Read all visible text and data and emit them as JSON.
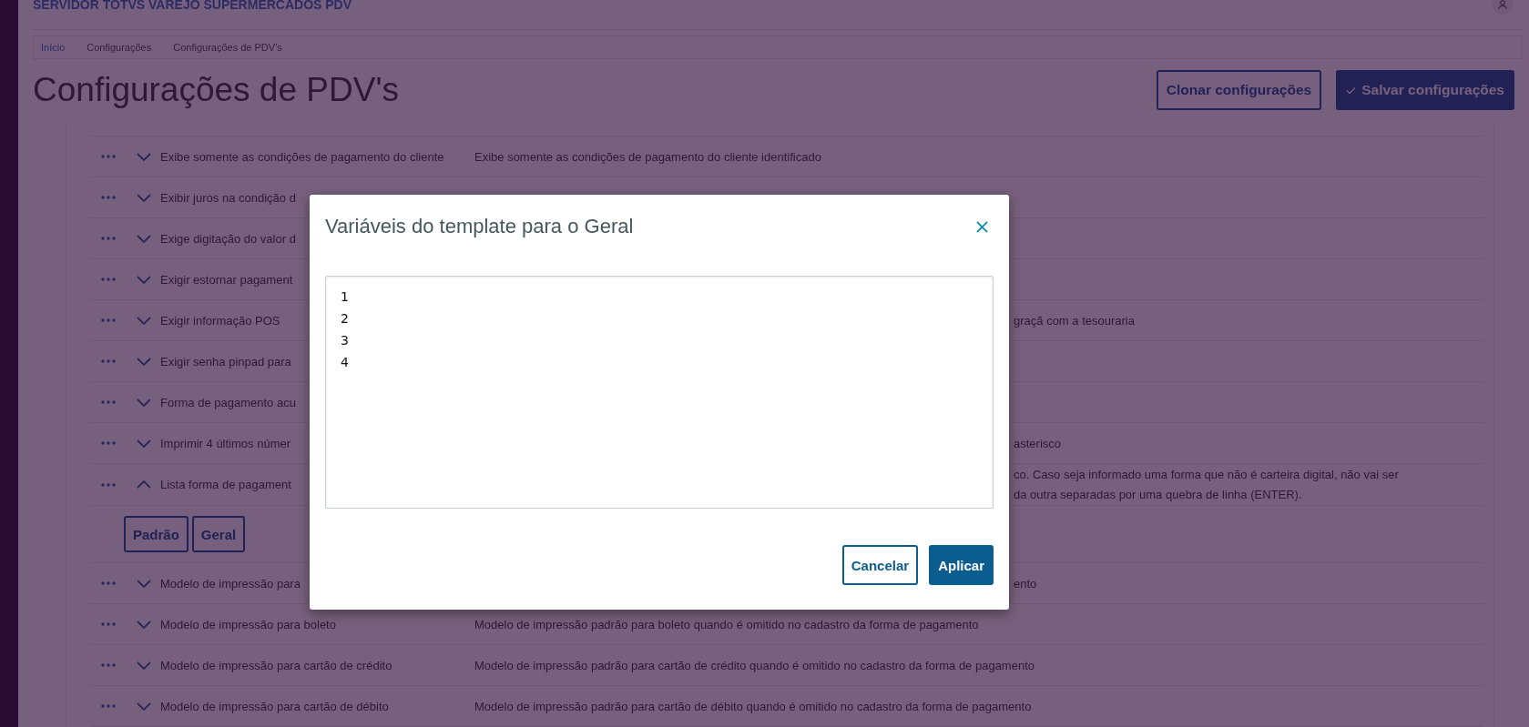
{
  "app": {
    "title": "SERVIDOR TOTVS VAREJO SUPERMERCADOS PDV"
  },
  "breadcrumb": [
    {
      "label": "Início",
      "link": true
    },
    {
      "label": "Configurações",
      "link": false
    },
    {
      "label": "Configurações de PDV's",
      "link": false
    }
  ],
  "page": {
    "title": "Configurações de PDV's",
    "buttons": [
      {
        "label": "Clonar configurações",
        "kind": "secondary"
      },
      {
        "label": "Salvar configurações",
        "kind": "primary"
      }
    ]
  },
  "settings": [
    {
      "name": "Exibe somente as condições de pagamento do cliente",
      "description": [
        "Exibe somente as condições de pagamento do cliente identificado"
      ],
      "expanded": false,
      "covered": false
    },
    {
      "name": "Exibir juros na condição d",
      "expanded": false,
      "covered": true
    },
    {
      "name": "Exige digitação do valor d",
      "expanded": false,
      "covered": true
    },
    {
      "name": "Exigir estornar pagament",
      "expanded": false,
      "covered": true
    },
    {
      "name": "Exigir informação POS",
      "description": [
        "graçã com a tesouraria"
      ],
      "expanded": false,
      "covered": true
    },
    {
      "name": "Exigir senha pinpad para",
      "expanded": false,
      "covered": true
    },
    {
      "name": "Forma de pagamento acu",
      "expanded": false,
      "covered": true
    },
    {
      "name": "Imprimir 4 últimos númer",
      "description": [
        "asterisco"
      ],
      "expanded": false,
      "covered": true
    },
    {
      "name": "Lista forma de pagament",
      "description": [
        "co. Caso seja informado uma forma que não é carteira digital, não vai ser",
        "da outra separadas por uma quebra de linha (ENTER)."
      ],
      "expanded": true,
      "covered": true,
      "templates": [
        "Padrão",
        "Geral"
      ]
    },
    {
      "name": "Modelo de impressão para",
      "description": [
        "ento"
      ],
      "expanded": false,
      "covered": true
    },
    {
      "name": "Modelo de impressão para boleto",
      "description": [
        "Modelo de impressão padrão para boleto quando é omitido no cadastro da forma de pagamento"
      ],
      "expanded": false,
      "covered": false
    },
    {
      "name": "Modelo de impressão para cartão de crédito",
      "description": [
        "Modelo de impressão padrão para cartão de crédito quando é omitido no cadastro da forma de pagamento"
      ],
      "expanded": false,
      "covered": false
    },
    {
      "name": "Modelo de impressão para cartão de débito",
      "description": [
        "Modelo de impressão padrão para cartão de débito quando é omitido no cadastro da forma de pagamento"
      ],
      "expanded": false,
      "covered": false
    }
  ],
  "modal": {
    "title": "Variáveis do template para o Geral",
    "value": "1\n2\n3\n4",
    "buttons": [
      {
        "label": "Cancelar",
        "kind": "secondary"
      },
      {
        "label": "Aplicar",
        "kind": "primary"
      }
    ]
  }
}
